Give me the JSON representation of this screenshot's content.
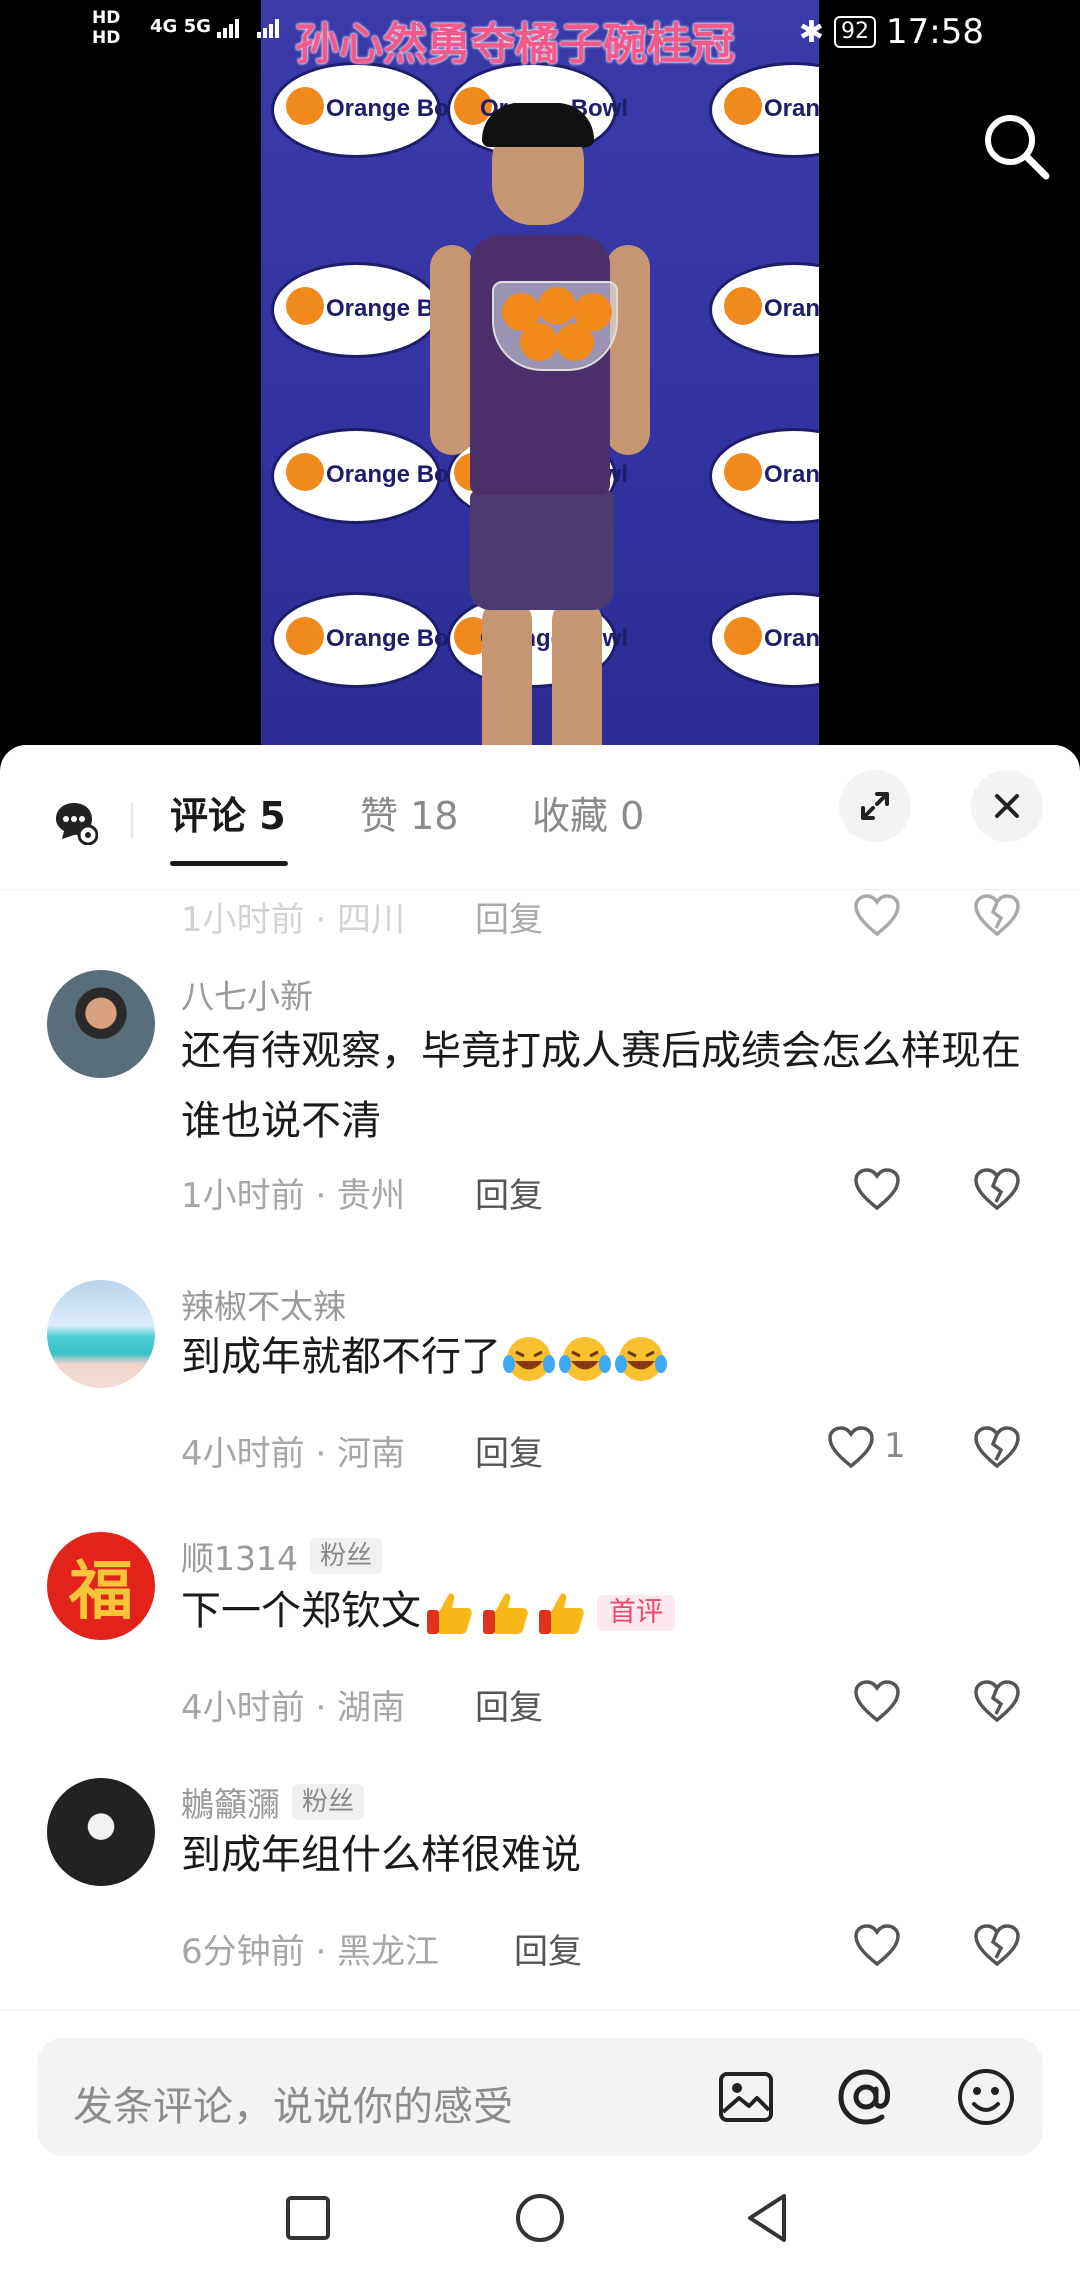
{
  "video": {
    "title_overlay": "孙心然勇夺橘子碗桂冠",
    "logo_text": "Orange Bowl"
  },
  "status_bar": {
    "hd1": "HD",
    "hd2": "HD",
    "network": "4G 5G",
    "battery": "92",
    "time": "17:58"
  },
  "sheet": {
    "tabs": [
      {
        "label": "评论 5",
        "active": true
      },
      {
        "label": "赞 18",
        "active": false
      },
      {
        "label": "收藏 0",
        "active": false
      }
    ]
  },
  "comments": [
    {
      "user": "",
      "text": "",
      "time_location": "1小时前 · 四川",
      "reply": "回复",
      "likes": ""
    },
    {
      "user": "八七小新",
      "text": "还有待观察，毕竟打成人赛后成绩会怎么样现在谁也说不清",
      "time_location": "1小时前 · 贵州",
      "reply": "回复",
      "likes": ""
    },
    {
      "user": "辣椒不太辣",
      "text": "到成年就都不行了",
      "emoji": "laugh-cry-emoji",
      "time_location": "4小时前 · 河南",
      "reply": "回复",
      "likes": "1"
    },
    {
      "user": "顺1314",
      "badge": "粉丝",
      "text": "下一个郑钦文",
      "emoji": "thumbs-up-emoji",
      "first_badge": "首评",
      "time_location": "4小时前 · 湖南",
      "reply": "回复",
      "likes": "",
      "avatar_text": "福"
    },
    {
      "user": "鶒籲瀰",
      "badge": "粉丝",
      "text": "到成年组什么样很难说",
      "time_location": "6分钟前 · 黑龙江",
      "reply": "回复",
      "likes": ""
    }
  ],
  "input": {
    "placeholder": "发条评论，说说你的感受"
  },
  "icons": {
    "search": "search-icon",
    "expand": "expand-icon",
    "close": "close-icon",
    "image": "image-icon",
    "mention": "at-icon",
    "emoji": "smiley-icon"
  },
  "colors": {
    "title_pink": "#f35a8c",
    "first_badge": "#f0476a",
    "backdrop_blue": "#3232a0"
  }
}
